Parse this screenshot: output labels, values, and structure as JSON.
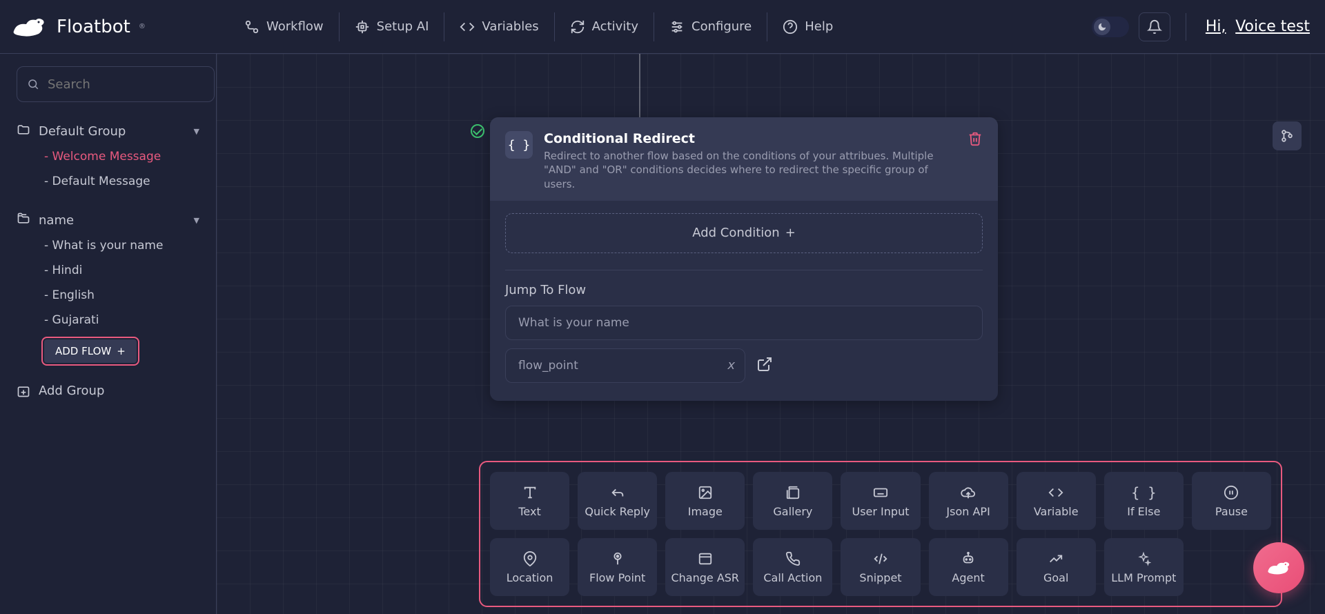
{
  "brand": "Floatbot",
  "nav": [
    {
      "label": "Workflow",
      "icon": "workflow"
    },
    {
      "label": "Setup AI",
      "icon": "chip"
    },
    {
      "label": "Variables",
      "icon": "code"
    },
    {
      "label": "Activity",
      "icon": "activity"
    },
    {
      "label": "Configure",
      "icon": "sliders"
    },
    {
      "label": "Help",
      "icon": "help"
    }
  ],
  "greeting_prefix": "Hi,",
  "greeting_user": "Voice test",
  "search": {
    "placeholder": "Search"
  },
  "groups": [
    {
      "name": "Default Group",
      "flows": [
        {
          "name": "Welcome Message",
          "active": true
        },
        {
          "name": "Default Message",
          "active": false
        }
      ],
      "add_flow": false
    },
    {
      "name": "name",
      "flows": [
        {
          "name": "What is your name",
          "active": false
        },
        {
          "name": "Hindi",
          "active": false
        },
        {
          "name": "English",
          "active": false
        },
        {
          "name": "Gujarati",
          "active": false
        }
      ],
      "add_flow": true
    }
  ],
  "add_flow_label": "ADD FLOW",
  "add_group_label": "Add Group",
  "card": {
    "title": "Conditional Redirect",
    "desc": "Redirect to another flow based on the conditions of your attribues. Multiple \"AND\" and \"OR\" conditions decides where to redirect the specific group of users.",
    "add_condition_label": "Add Condition",
    "jump_label": "Jump To Flow",
    "jump_value": "What is your name",
    "flow_point_value": "flow_point"
  },
  "blocks_row1": [
    {
      "label": "Text",
      "icon": "text"
    },
    {
      "label": "Quick Reply",
      "icon": "reply"
    },
    {
      "label": "Image",
      "icon": "image"
    },
    {
      "label": "Gallery",
      "icon": "gallery"
    },
    {
      "label": "User Input",
      "icon": "keyboard"
    },
    {
      "label": "Json API",
      "icon": "cloud"
    },
    {
      "label": "Variable",
      "icon": "code"
    },
    {
      "label": "If Else",
      "icon": "braces"
    },
    {
      "label": "Pause",
      "icon": "pause"
    }
  ],
  "blocks_row2": [
    {
      "label": "Location",
      "icon": "pin"
    },
    {
      "label": "Flow Point",
      "icon": "flowpoint"
    },
    {
      "label": "Change ASR",
      "icon": "window"
    },
    {
      "label": "Call Action",
      "icon": "phone"
    },
    {
      "label": "Snippet",
      "icon": "snippet"
    },
    {
      "label": "Agent",
      "icon": "agent"
    },
    {
      "label": "Goal",
      "icon": "goal"
    },
    {
      "label": "LLM Prompt",
      "icon": "sparkle"
    },
    {
      "label": "",
      "icon": "",
      "empty": true
    }
  ]
}
